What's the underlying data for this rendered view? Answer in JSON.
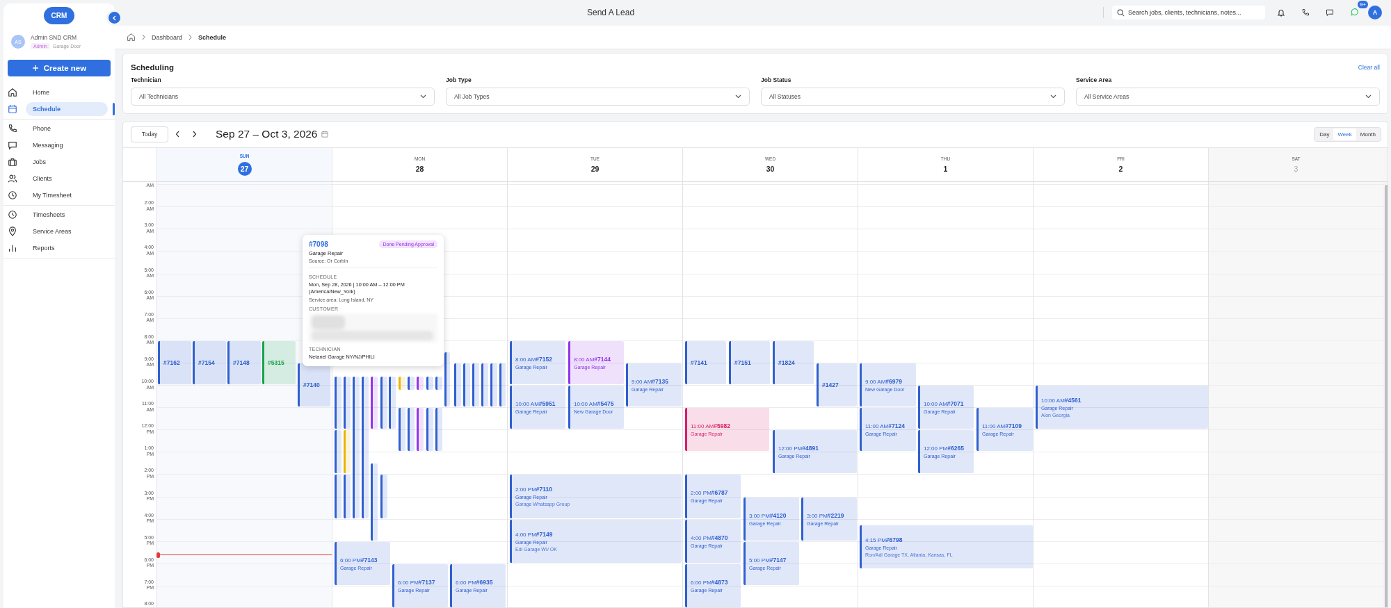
{
  "top_bar": {
    "title": "Send A Lead",
    "search": {
      "placeholder": "Search jobs, clients, technicians, notes..."
    },
    "messages_badge": "9+",
    "avatar": "A"
  },
  "sidebar": {
    "logo": "CRM",
    "user": {
      "initials": "AS",
      "name": "Admin SND CRM",
      "role": "Admin",
      "company": "Garage Door"
    },
    "create_button": "Create new",
    "groups": [
      [
        {
          "label": "Home",
          "selected": false
        },
        {
          "label": "Schedule",
          "selected": true
        }
      ],
      [
        {
          "label": "Phone",
          "selected": false
        },
        {
          "label": "Messaging",
          "selected": false
        },
        {
          "label": "Jobs",
          "selected": false
        },
        {
          "label": "Clients",
          "selected": false
        },
        {
          "label": "My Timesheet",
          "selected": false
        }
      ],
      [
        {
          "label": "Timesheets",
          "selected": false
        },
        {
          "label": "Service Areas",
          "selected": false
        },
        {
          "label": "Reports",
          "selected": false
        }
      ]
    ]
  },
  "breadcrumb": [
    "Dashboard",
    "Schedule"
  ],
  "filters": {
    "title": "Scheduling",
    "clear": "Clear all",
    "fields": [
      {
        "label": "Technician",
        "value": "All Technicians"
      },
      {
        "label": "Job Type",
        "value": "All Job Types"
      },
      {
        "label": "Job Status",
        "value": "All Statuses"
      },
      {
        "label": "Service Area",
        "value": "All Service Areas"
      }
    ]
  },
  "calendar": {
    "today_button": "Today",
    "range": "Sep 27 – Oct 3, 2026",
    "views": [
      {
        "label": "Day",
        "selected": false
      },
      {
        "label": "Week",
        "selected": true
      },
      {
        "label": "Month",
        "selected": false
      }
    ],
    "hours": [
      {
        "period": "AM"
      },
      {
        "time": "2:00",
        "period": "AM"
      },
      {
        "time": "3:00",
        "period": "AM"
      },
      {
        "time": "4:00",
        "period": "AM"
      },
      {
        "time": "5:00",
        "period": "AM"
      },
      {
        "time": "6:00",
        "period": "AM"
      },
      {
        "time": "7:00",
        "period": "AM"
      },
      {
        "time": "8:00",
        "period": "AM"
      },
      {
        "time": "9:00",
        "period": "AM"
      },
      {
        "time": "10:00",
        "period": "AM"
      },
      {
        "time": "11:00",
        "period": "AM"
      },
      {
        "time": "12:00",
        "period": "PM"
      },
      {
        "time": "1:00",
        "period": "PM"
      },
      {
        "time": "2:00",
        "period": "PM"
      },
      {
        "time": "3:00",
        "period": "PM"
      },
      {
        "time": "4:00",
        "period": "PM"
      },
      {
        "time": "5:00",
        "period": "PM"
      },
      {
        "time": "6:00",
        "period": "PM"
      },
      {
        "time": "7:00",
        "period": "PM"
      },
      {
        "time": "8:00"
      }
    ],
    "days": [
      {
        "weekday": "SUN",
        "date": "27",
        "selected": true,
        "disabled": false,
        "events": [
          {
            "id": "#7162",
            "color": "#2f5fd0"
          },
          {
            "id": "#7154",
            "color": "#2f5fd0"
          },
          {
            "id": "#7148",
            "color": "#2f5fd0"
          },
          {
            "id": "#5315",
            "color": "#16a34a"
          },
          {
            "id": "#7140",
            "color": "#2f5fd0"
          }
        ]
      },
      {
        "weekday": "MON",
        "date": "28",
        "selected": false,
        "disabled": false,
        "events": [
          {
            "color": "#2f5fd0"
          },
          {
            "color": "#2f5fd0"
          },
          {
            "color": "#2f5fd0"
          },
          {
            "color": "#2f5fd0"
          },
          {
            "color": "#eab308"
          },
          {
            "color": "#2f5fd0"
          },
          {
            "color": "#2f5fd0"
          },
          {
            "color": "#2f5fd0"
          },
          {
            "color": "#9333ea"
          },
          {
            "color": "#2f5fd0"
          },
          {
            "color": "#2f5fd0"
          },
          {
            "color": "#2f5fd0"
          },
          {
            "color": "#2f5fd0"
          },
          {
            "color": "#eab308"
          },
          {
            "color": "#2f5fd0"
          },
          {
            "color": "#2f5fd0"
          },
          {
            "color": "#2f5fd0"
          },
          {
            "color": "#9333ea"
          },
          {
            "color": "#9333ea"
          },
          {
            "color": "#2f5fd0"
          },
          {
            "color": "#2f5fd0"
          },
          {
            "color": "#2f5fd0"
          },
          {
            "color": "#2f5fd0"
          },
          {
            "color": "#2f5fd0"
          },
          {
            "color": "#2f5fd0"
          },
          {
            "color": "#2f5fd0"
          },
          {
            "color": "#2f5fd0"
          },
          {
            "color": "#2f5fd0"
          },
          {
            "color": "#2f5fd0"
          },
          {
            "color": "#2f5fd0"
          },
          {
            "id": "#7143",
            "time": "6:00 PM",
            "type": "Garage Repair",
            "color": "#2f5fd0"
          },
          {
            "id": "#7137",
            "time": "6:00 PM",
            "type": "Garage Repair",
            "color": "#2f5fd0"
          },
          {
            "id": "#6935",
            "time": "6:00 PM",
            "type": "Garage Repair",
            "color": "#2f5fd0"
          }
        ]
      },
      {
        "weekday": "TUE",
        "date": "29",
        "selected": false,
        "disabled": false,
        "events": [
          {
            "id": "#7152",
            "time": "8:00 AM",
            "type": "Garage Repair",
            "color": "#2f5fd0"
          },
          {
            "id": "#5951",
            "time": "10:00 AM",
            "type": "Garage Repair",
            "color": "#2f5fd0"
          },
          {
            "id": "#7144",
            "time": "8:00 AM",
            "type": "Garage Repair",
            "color": "#9333ea"
          },
          {
            "id": "#5475",
            "time": "10:00 AM",
            "type": "New Garage Door",
            "color": "#2f5fd0"
          },
          {
            "id": "#7135",
            "time": "9:00 AM",
            "type": "Garage Repair",
            "color": "#2f5fd0"
          },
          {
            "id": "#7110",
            "time": "2:00 PM",
            "type": "Garage Repair",
            "source": "Garage Whatsapp Group",
            "color": "#2f5fd0"
          },
          {
            "id": "#7149",
            "time": "4:00 PM",
            "type": "Garage Repair",
            "source": "Edi Garage WI/ OK",
            "color": "#2f5fd0"
          }
        ]
      },
      {
        "weekday": "WED",
        "date": "30",
        "selected": false,
        "disabled": false,
        "events": [
          {
            "id": "#7141",
            "color": "#2f5fd0"
          },
          {
            "id": "#7151",
            "color": "#2f5fd0"
          },
          {
            "id": "#1824",
            "color": "#2f5fd0"
          },
          {
            "id": "#1427",
            "color": "#2f5fd0"
          },
          {
            "id": "#5982",
            "time": "11:00 AM",
            "type": "Garage Repair",
            "color": "#d61f69"
          },
          {
            "id": "#4891",
            "time": "12:00 PM",
            "type": "Garage Repair",
            "color": "#2f5fd0"
          },
          {
            "id": "#6787",
            "time": "2:00 PM",
            "type": "Garage Repair",
            "color": "#2f5fd0"
          },
          {
            "id": "#4870",
            "time": "4:00 PM",
            "type": "Garage Repair",
            "color": "#2f5fd0"
          },
          {
            "id": "#4873",
            "time": "6:00 PM",
            "type": "Garage Repair",
            "color": "#2f5fd0"
          },
          {
            "id": "#4120",
            "time": "3:00 PM",
            "type": "Garage Repair",
            "color": "#2f5fd0"
          },
          {
            "id": "#7147",
            "time": "5:00 PM",
            "type": "Garage Repair",
            "color": "#2f5fd0"
          },
          {
            "id": "#2219",
            "time": "3:00 PM",
            "type": "Garage Repair",
            "color": "#2f5fd0"
          }
        ]
      },
      {
        "weekday": "THU",
        "date": "1",
        "selected": false,
        "disabled": false,
        "events": [
          {
            "id": "#6979",
            "time": "9:00 AM",
            "type": "New Garage Door",
            "color": "#2f5fd0"
          },
          {
            "id": "#7124",
            "time": "11:00 AM",
            "type": "Garage Repair",
            "color": "#2f5fd0"
          },
          {
            "id": "#7071",
            "time": "10:00 AM",
            "type": "Garage Repair",
            "color": "#2f5fd0"
          },
          {
            "id": "#6265",
            "time": "12:00 PM",
            "type": "Garage Repair",
            "color": "#2f5fd0"
          },
          {
            "id": "#7109",
            "time": "11:00 AM",
            "type": "Garage Repair",
            "color": "#2f5fd0"
          },
          {
            "id": "#6798",
            "time": "4:15 PM",
            "type": "Garage Repair",
            "source": "Ron/Adi Garage TX, Atlanta, Kansas, FL",
            "color": "#2f5fd0"
          }
        ]
      },
      {
        "weekday": "FRI",
        "date": "2",
        "selected": false,
        "disabled": false,
        "events": [
          {
            "id": "#4561",
            "time": "10:00 AM",
            "type": "Garage Repair",
            "source": "Alon Georgia",
            "color": "#2f5fd0"
          }
        ]
      },
      {
        "weekday": "SAT",
        "date": "3",
        "selected": false,
        "disabled": true
      }
    ],
    "popover": {
      "id": "#7098",
      "status": "Done Pending Approval",
      "type": "Garage Repair",
      "source": "Source: Or Corbin",
      "schedule_heading": "SCHEDULE",
      "schedule": "Mon, Sep 28, 2026 | 10:00 AM – 12:00 PM (America/New_York)",
      "service_area": "Service area: Long Island, NY",
      "customer_heading": "CUSTOMER",
      "technician_heading": "TECHNICIAN",
      "technician": "Netanel Garage NY/NJ/PHILI"
    }
  }
}
